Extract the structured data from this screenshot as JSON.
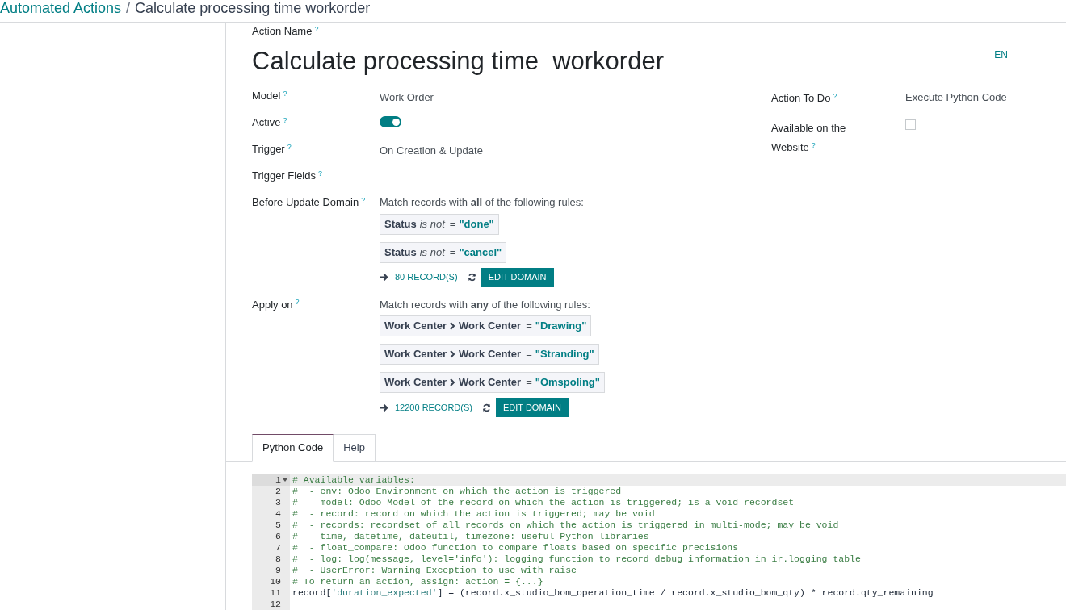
{
  "breadcrumb": {
    "parent": "Automated Actions",
    "separator": "/",
    "current": "Calculate processing time workorder"
  },
  "action_name": {
    "label": "Action Name",
    "help": "?",
    "value": "Calculate processing time  workorder",
    "language": "EN"
  },
  "left_fields": [
    {
      "label": "Model",
      "help": "?",
      "kind": "text",
      "value": "Work Order"
    },
    {
      "label": "Active",
      "help": "?",
      "kind": "toggle",
      "on": true
    },
    {
      "label": "Trigger",
      "help": "?",
      "kind": "text",
      "value": "On Creation & Update"
    },
    {
      "label": "Trigger Fields",
      "help": "?",
      "kind": "empty"
    }
  ],
  "right_fields": [
    {
      "label": "Action To Do",
      "help": "?",
      "kind": "text",
      "value": "Execute Python Code"
    },
    {
      "label": "Available on the Website",
      "help": "?",
      "kind": "checkbox",
      "checked": false
    }
  ],
  "domains": [
    {
      "label": "Before Update Domain",
      "help": "?",
      "intro": "Match records with **all** of the following rules:",
      "rules": [
        {
          "path": [
            "Status"
          ],
          "operator": "is not",
          "symbol": "=",
          "value": "\"done\""
        },
        {
          "path": [
            "Status"
          ],
          "operator": "is not",
          "symbol": "=",
          "value": "\"cancel\""
        }
      ],
      "records": "80 RECORD(S)",
      "button": "EDIT DOMAIN"
    },
    {
      "label": "Apply on",
      "help": "?",
      "intro": "Match records with **any** of the following rules:",
      "rules": [
        {
          "path": [
            "Work Center",
            "Work Center"
          ],
          "symbol": "=",
          "value": "\"Drawing\""
        },
        {
          "path": [
            "Work Center",
            "Work Center"
          ],
          "symbol": "=",
          "value": "\"Stranding\""
        },
        {
          "path": [
            "Work Center",
            "Work Center"
          ],
          "symbol": "=",
          "value": "\"Omspoling\""
        }
      ],
      "records": "12200 RECORD(S)",
      "button": "EDIT DOMAIN"
    }
  ],
  "tabs": [
    {
      "label": "Python Code",
      "selected": true
    },
    {
      "label": "Help",
      "selected": false
    }
  ],
  "code": {
    "lines": [
      {
        "number": "1",
        "active": true,
        "foldable": true,
        "tokens": [
          {
            "kind": "comment",
            "text": "# Available variables:"
          }
        ]
      },
      {
        "number": "2",
        "active": false,
        "foldable": false,
        "tokens": [
          {
            "kind": "comment",
            "text": "#  - env: Odoo Environment on which the action is triggered"
          }
        ]
      },
      {
        "number": "3",
        "active": false,
        "foldable": false,
        "tokens": [
          {
            "kind": "comment",
            "text": "#  - model: Odoo Model of the record on which the action is triggered; is a void recordset"
          }
        ]
      },
      {
        "number": "4",
        "active": false,
        "foldable": false,
        "tokens": [
          {
            "kind": "comment",
            "text": "#  - record: record on which the action is triggered; may be void"
          }
        ]
      },
      {
        "number": "5",
        "active": false,
        "foldable": false,
        "tokens": [
          {
            "kind": "comment",
            "text": "#  - records: recordset of all records on which the action is triggered in multi-mode; may be void"
          }
        ]
      },
      {
        "number": "6",
        "active": false,
        "foldable": false,
        "tokens": [
          {
            "kind": "comment",
            "text": "#  - time, datetime, dateutil, timezone: useful Python libraries"
          }
        ]
      },
      {
        "number": "7",
        "active": false,
        "foldable": false,
        "tokens": [
          {
            "kind": "comment",
            "text": "#  - float_compare: Odoo function to compare floats based on specific precisions"
          }
        ]
      },
      {
        "number": "8",
        "active": false,
        "foldable": false,
        "tokens": [
          {
            "kind": "comment",
            "text": "#  - log: log(message, level='info'): logging function to record debug information in ir.logging table"
          }
        ]
      },
      {
        "number": "9",
        "active": false,
        "foldable": false,
        "tokens": [
          {
            "kind": "comment",
            "text": "#  - UserError: Warning Exception to use with raise"
          }
        ]
      },
      {
        "number": "10",
        "active": false,
        "foldable": false,
        "tokens": [
          {
            "kind": "comment",
            "text": "# To return an action, assign: action = {...}"
          }
        ]
      },
      {
        "number": "11",
        "active": false,
        "foldable": false,
        "tokens": [
          {
            "kind": "plain",
            "text": "record["
          },
          {
            "kind": "string",
            "text": "'duration_expected'"
          },
          {
            "kind": "plain",
            "text": "] = (record.x_studio_bom_operation_time / record.x_studio_bom_qty) * record.qty_remaining"
          }
        ]
      },
      {
        "number": "12",
        "active": false,
        "foldable": false
      }
    ]
  }
}
